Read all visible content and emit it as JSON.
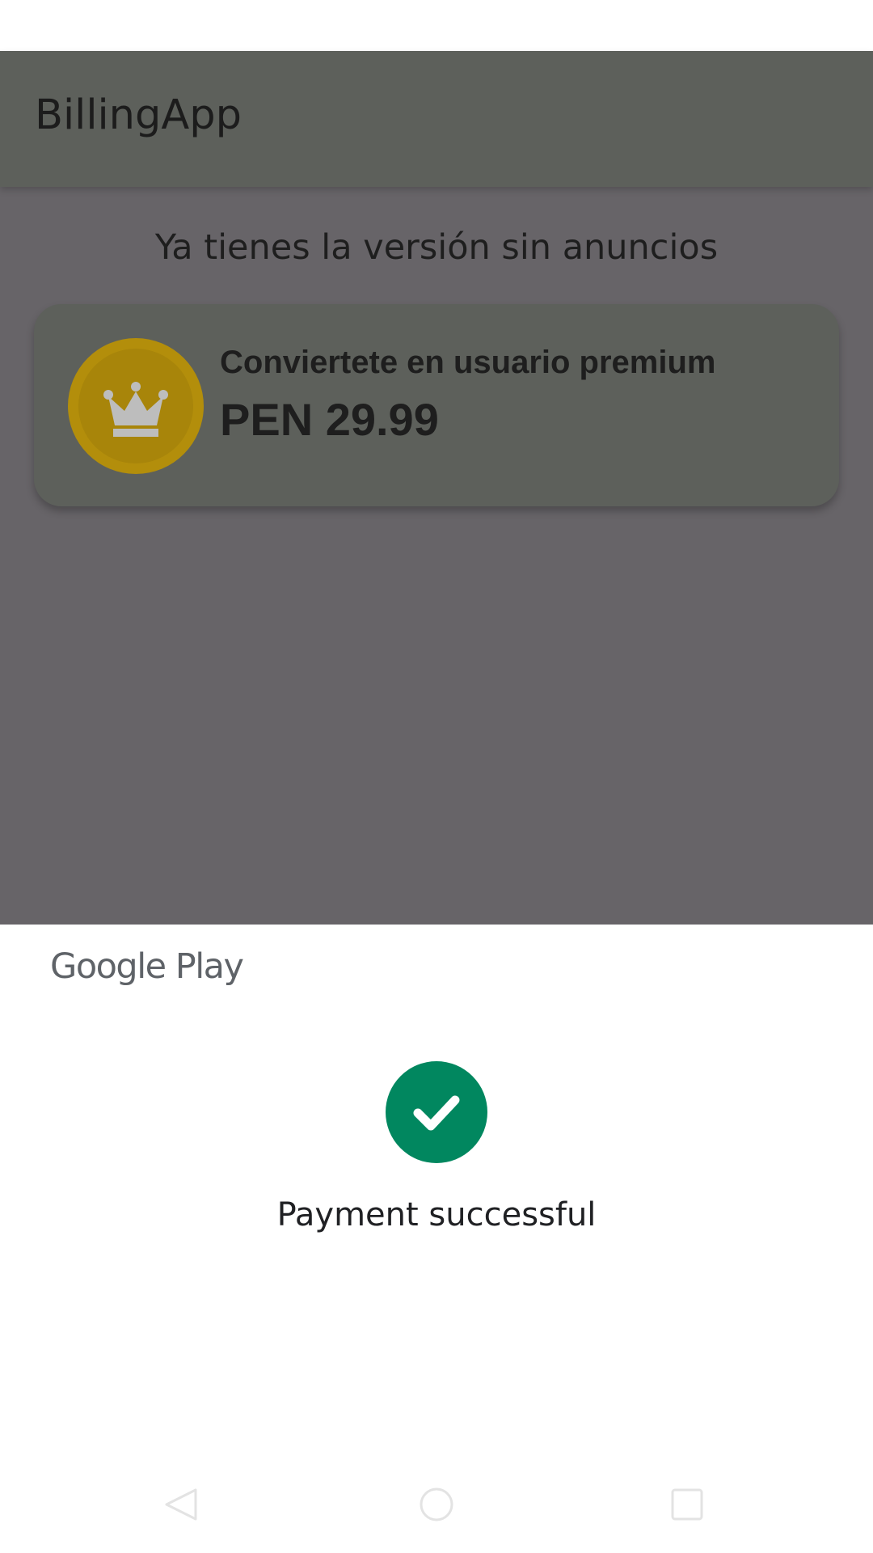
{
  "app": {
    "title": "BillingApp"
  },
  "main": {
    "message": "Ya tienes la versión sin anuncios",
    "product": {
      "title": "Conviertete en usuario premium",
      "price": "PEN 29.99",
      "icon": "crown-coin-icon"
    }
  },
  "payment_sheet": {
    "brand": "Google Play",
    "status_icon": "check-circle-icon",
    "status_text": "Payment successful"
  },
  "system_nav": {
    "back": "back-icon",
    "home": "home-icon",
    "recents": "recents-icon"
  },
  "colors": {
    "app_bar_scrim": "#5d605b",
    "content_scrim": "#676468",
    "coin": "#b38e0b",
    "success_green": "#01875f",
    "google_gray": "#5f6368"
  }
}
